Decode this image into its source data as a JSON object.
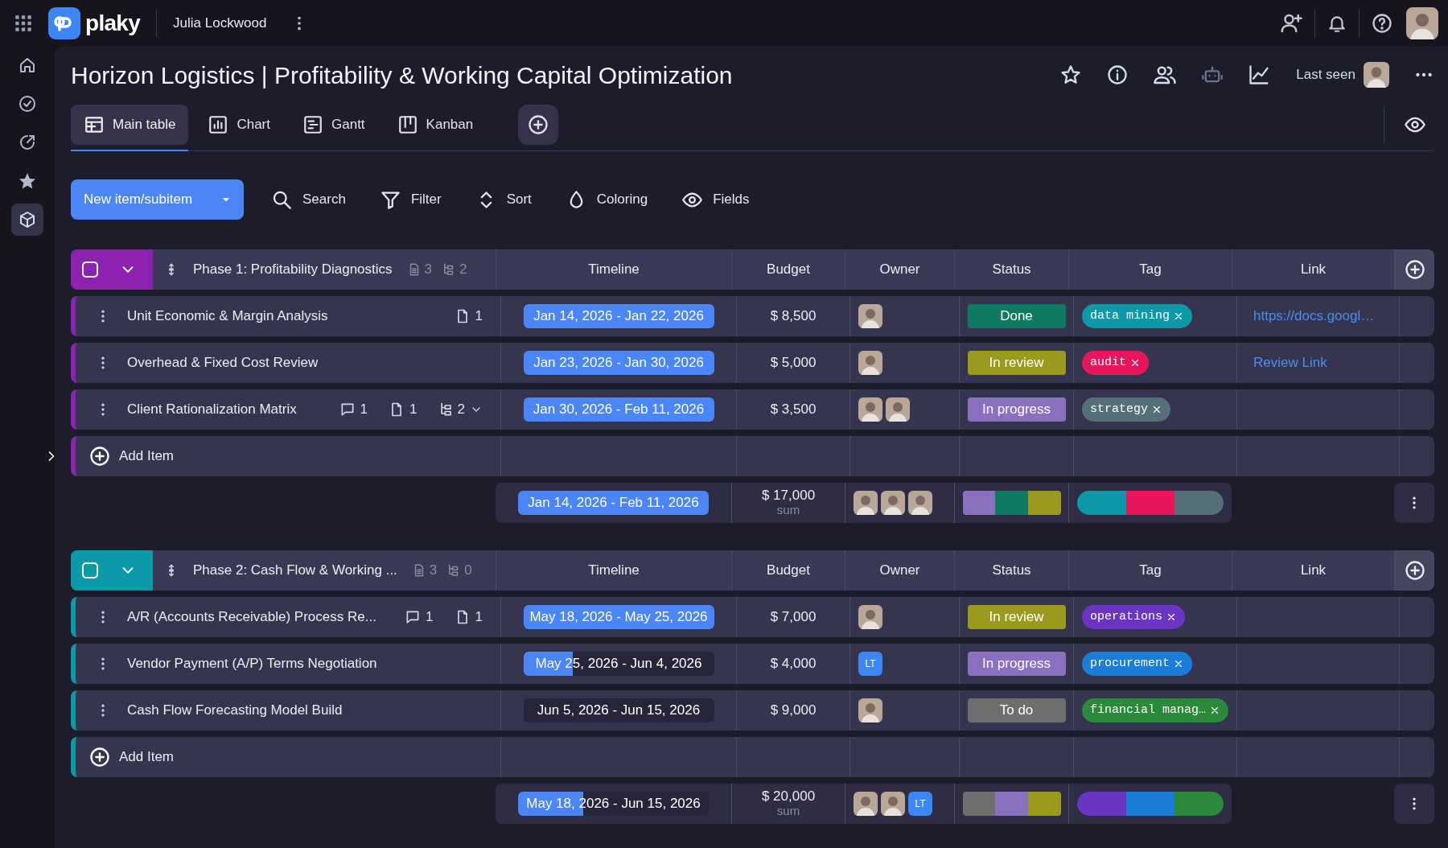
{
  "topbar": {
    "brand": "plaky",
    "workspace": "Julia Lockwood"
  },
  "sidebar": {
    "items": [
      {
        "selected": false
      },
      {
        "selected": false
      },
      {
        "selected": false
      },
      {
        "selected": false
      },
      {
        "selected": true
      }
    ]
  },
  "board": {
    "title": "Horizon Logistics | Profitability & Working Capital Optimization",
    "last_seen": "Last seen"
  },
  "tabs": [
    {
      "label": "Main table",
      "selected": true
    },
    {
      "label": "Chart",
      "selected": false
    },
    {
      "label": "Gantt",
      "selected": false
    },
    {
      "label": "Kanban",
      "selected": false
    }
  ],
  "toolbar": {
    "new_button": "New item/subitem",
    "actions": [
      "Search",
      "Filter",
      "Sort",
      "Coloring",
      "Fields"
    ]
  },
  "groups": [
    {
      "title": "Phase 1: Profitability Diagnostics",
      "color": "#8e22b0",
      "checked": false,
      "expanded": true,
      "files": "3",
      "subitems": "2",
      "columns": [
        "Timeline",
        "Budget",
        "Owner",
        "Status",
        "Tag",
        "Link"
      ],
      "items": [
        {
          "name": "Unit Economic & Margin Analysis",
          "files": "1",
          "timeline": {
            "text": "Jan 14, 2026 - Jan 22, 2026",
            "level": 1
          },
          "budget": "$ 8,500",
          "owners": [
            {
              "kind": "photo"
            }
          ],
          "status": {
            "text": "Done",
            "color": "#0e7a62"
          },
          "tag": {
            "text": "data mining",
            "color": "#0c9aa8"
          },
          "link": "https://docs.googl…"
        },
        {
          "name": "Overhead & Fixed Cost Review",
          "timeline": {
            "text": "Jan 23, 2026 - Jan 30, 2026",
            "level": 1
          },
          "budget": "$ 5,000",
          "owners": [
            {
              "kind": "photo"
            }
          ],
          "status": {
            "text": "In review",
            "color": "#9a9b1e"
          },
          "tag": {
            "text": "audit",
            "color": "#e8175d"
          },
          "link": "Review Link"
        },
        {
          "name": "Client Rationalization Matrix",
          "comments": "1",
          "files": "1",
          "subitems": "2",
          "subitems_expanded": false,
          "timeline": {
            "text": "Jan 30, 2026 - Feb 11, 2026",
            "level": 1
          },
          "budget": "$ 3,500",
          "owners": [
            {
              "kind": "photo"
            },
            {
              "kind": "photo"
            }
          ],
          "status": {
            "text": "In progress",
            "color": "#8c70c0"
          },
          "tag": {
            "text": "strategy",
            "color": "#56707a"
          }
        }
      ],
      "add_item": "Add Item",
      "summary": {
        "timeline": {
          "text": "Jan 14, 2026 - Feb 11, 2026",
          "level": 1
        },
        "budget": "$ 17,000",
        "budget_label": "sum",
        "owners": [
          {
            "kind": "photo"
          },
          {
            "kind": "photo"
          },
          {
            "kind": "photo"
          }
        ],
        "status_segments": [
          {
            "color": "#8c70c0"
          },
          {
            "color": "#0e7a62"
          },
          {
            "color": "#9a9b1e"
          }
        ],
        "tag_segments": [
          {
            "color": "#0c9aa8"
          },
          {
            "color": "#e8175d"
          },
          {
            "color": "#56707a"
          }
        ]
      }
    },
    {
      "title": "Phase 2: Cash Flow & Working ...",
      "color": "#0c9aa8",
      "checked": false,
      "expanded": true,
      "files": "3",
      "subitems": "0",
      "columns": [
        "Timeline",
        "Budget",
        "Owner",
        "Status",
        "Tag",
        "Link"
      ],
      "items": [
        {
          "name": "A/R (Accounts Receivable) Process Re...",
          "comments": "1",
          "files": "1",
          "timeline": {
            "text": "May 18, 2026 - May 25, 2026",
            "level": 1
          },
          "budget": "$ 7,000",
          "owners": [
            {
              "kind": "photo"
            }
          ],
          "status": {
            "text": "In review",
            "color": "#9a9b1e"
          },
          "tag": {
            "text": "operations",
            "color": "#6b35c4"
          }
        },
        {
          "name": "Vendor Payment (A/P) Terms Negotiation",
          "timeline": {
            "text": "May 25, 2026 - Jun 4, 2026",
            "level": 0.26
          },
          "budget": "$ 4,000",
          "owners": [
            {
              "kind": "initials",
              "text": "LT"
            }
          ],
          "status": {
            "text": "In progress",
            "color": "#8c70c0"
          },
          "tag": {
            "text": "procurement",
            "color": "#1a7ed8"
          }
        },
        {
          "name": "Cash Flow Forecasting Model Build",
          "timeline": {
            "text": "Jun 5, 2026 - Jun 15, 2026",
            "level": 0
          },
          "budget": "$ 9,000",
          "owners": [
            {
              "kind": "photo"
            }
          ],
          "status": {
            "text": "To do",
            "color": "#6e6e6e"
          },
          "tag": {
            "text": "financial manag…",
            "color": "#2a8a3a"
          }
        }
      ],
      "add_item": "Add Item",
      "summary": {
        "timeline": {
          "text": "May 18, 2026 - Jun 15, 2026",
          "level": 0.34
        },
        "budget": "$ 20,000",
        "budget_label": "sum",
        "owners": [
          {
            "kind": "photo"
          },
          {
            "kind": "photo"
          },
          {
            "kind": "initials",
            "text": "LT"
          }
        ],
        "status_segments": [
          {
            "color": "#6e6e6e"
          },
          {
            "color": "#8c70c0"
          },
          {
            "color": "#9a9b1e"
          }
        ],
        "tag_segments": [
          {
            "color": "#6b35c4"
          },
          {
            "color": "#1a7ed8"
          },
          {
            "color": "#2a8a3a"
          }
        ]
      }
    }
  ]
}
